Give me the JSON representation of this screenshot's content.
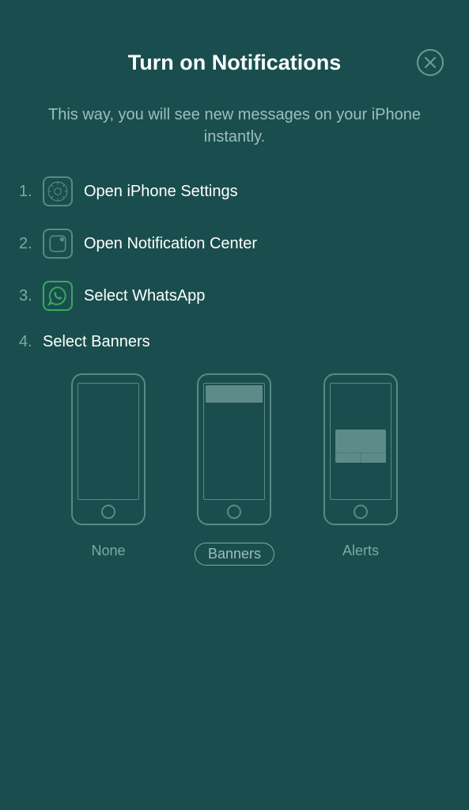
{
  "header": {
    "title": "Turn on Notifications",
    "subtitle": "This way, you will see new messages on your iPhone instantly."
  },
  "steps": [
    {
      "num": "1.",
      "label": "Open iPhone Settings",
      "icon": "gear"
    },
    {
      "num": "2.",
      "label": "Open Notification Center",
      "icon": "notification"
    },
    {
      "num": "3.",
      "label": "Select WhatsApp",
      "icon": "whatsapp"
    },
    {
      "num": "4.",
      "label": "Select Banners",
      "icon": null
    }
  ],
  "options": {
    "none": "None",
    "banners": "Banners",
    "alerts": "Alerts"
  }
}
